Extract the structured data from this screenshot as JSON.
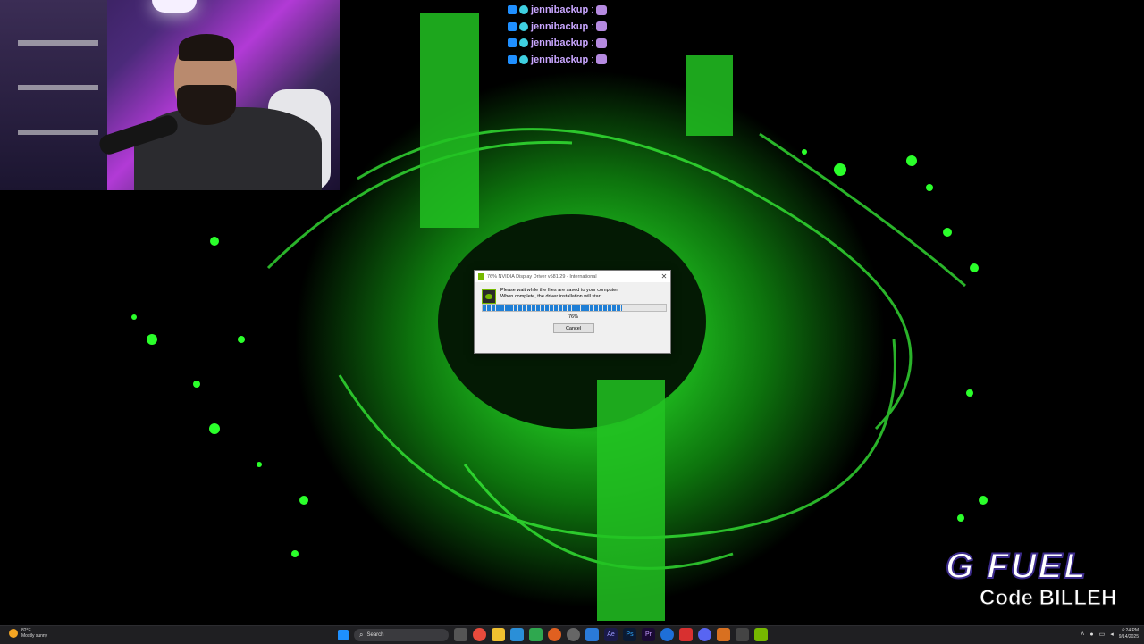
{
  "chat": {
    "messages": [
      {
        "user": "jennibackup",
        "sep": ":"
      },
      {
        "user": "jennibackup",
        "sep": ":"
      },
      {
        "user": "jennibackup",
        "sep": ":"
      },
      {
        "user": "jennibackup",
        "sep": ":"
      }
    ]
  },
  "dialog": {
    "title": "76% NVIDIA Display Driver v581.29 - International",
    "message_line1": "Please wait while the files are saved to your computer.",
    "message_line2": "When complete, the driver installation will start.",
    "progress_percent": 76,
    "progress_label": "76%",
    "cancel_label": "Cancel"
  },
  "overlay": {
    "brand": "G FUEL",
    "code": "Code BILLEH"
  },
  "taskbar": {
    "weather_temp": "82°F",
    "weather_desc": "Mostly sunny",
    "search_label": "Search",
    "time": "6:24 PM",
    "date": "9/14/2025"
  },
  "colors": {
    "accent_green": "#76b900",
    "progress_blue": "#1f7fd6",
    "chat_user": "#c9a6ff"
  }
}
